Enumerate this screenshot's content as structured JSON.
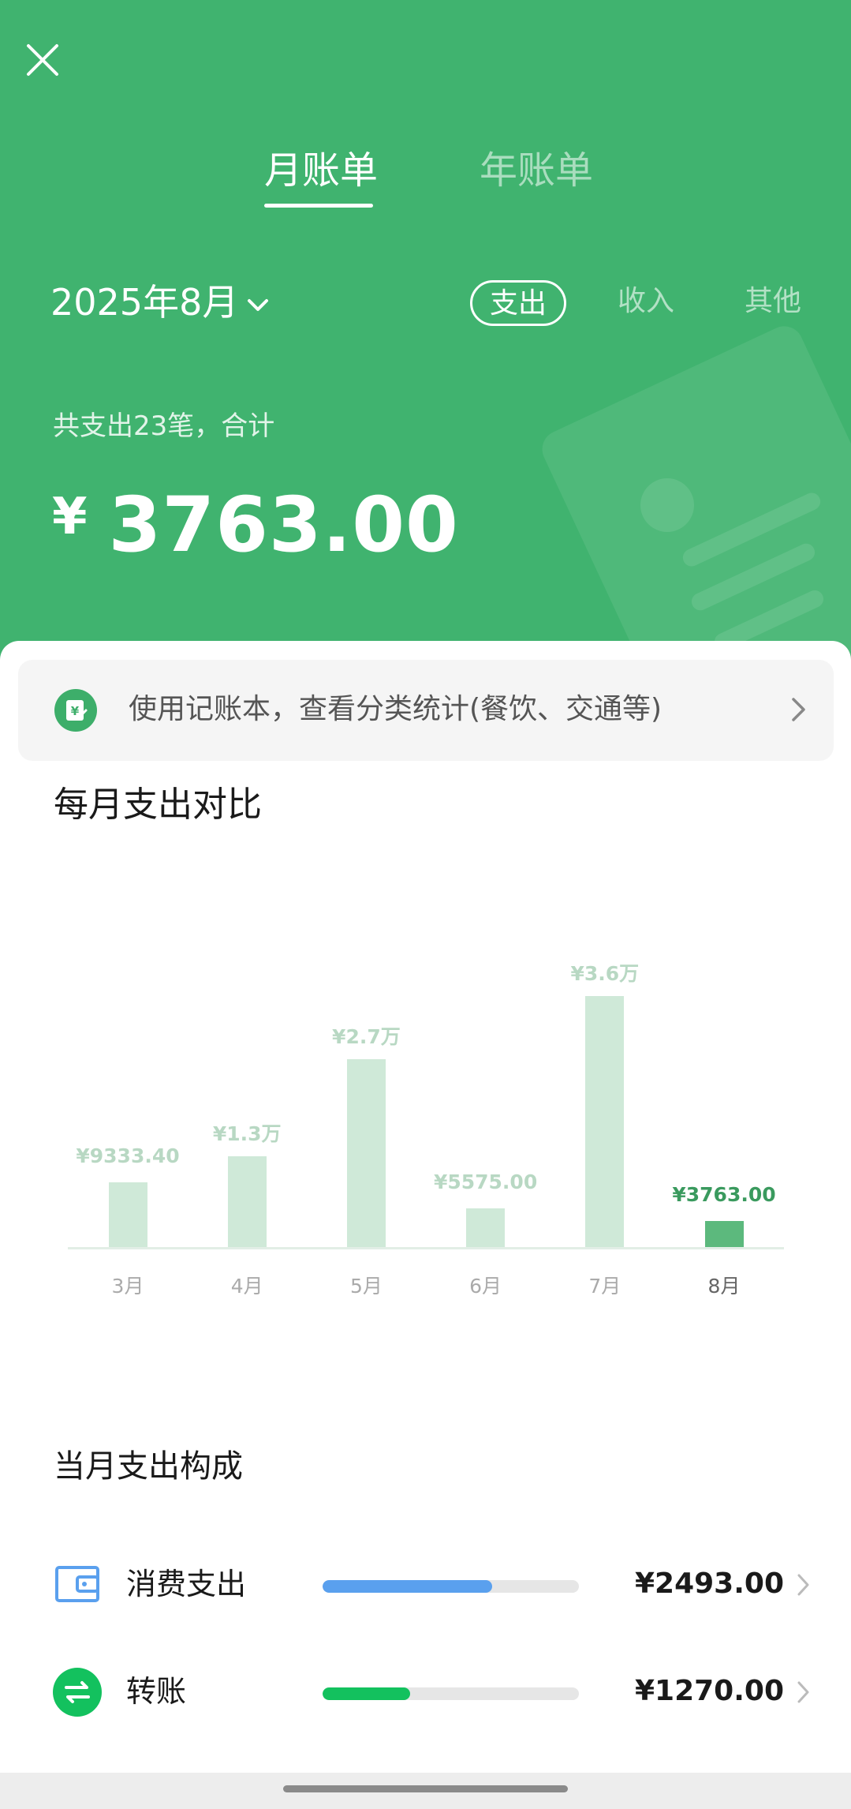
{
  "tabs": {
    "monthly": "月账单",
    "yearly": "年账单"
  },
  "period": {
    "label": "2025年8月"
  },
  "filters": {
    "expense": "支出",
    "income": "收入",
    "other": "其他"
  },
  "summary": {
    "text": "共支出23笔，合计",
    "currency": "¥",
    "amount": "3763.00"
  },
  "promo": {
    "text": "使用记账本，查看分类统计(餐饮、交通等)"
  },
  "comparison": {
    "title": "每月支出对比"
  },
  "chart_data": {
    "type": "bar",
    "categories": [
      "3月",
      "4月",
      "5月",
      "6月",
      "7月",
      "8月"
    ],
    "values": [
      9333.4,
      13000,
      27000,
      5575.0,
      36000,
      3763.0
    ],
    "data_labels": [
      "¥9333.40",
      "¥1.3万",
      "¥2.7万",
      "¥5575.00",
      "¥3.6万",
      "¥3763.00"
    ],
    "highlighted": "8月",
    "ylim": [
      0,
      36000
    ],
    "colors": {
      "bar": "#cfe9d8",
      "highlight": "#5cb97d"
    }
  },
  "composition": {
    "title": "当月支出构成",
    "items": [
      {
        "label": "消费支出",
        "amount": "¥2493.00",
        "share": 0.66,
        "color": "#5aa0ee",
        "icon": "wallet-icon"
      },
      {
        "label": "转账",
        "amount": "¥1270.00",
        "share": 0.34,
        "color": "#13c15e",
        "icon": "transfer-icon"
      }
    ]
  },
  "colors": {
    "brand": "#40b36f",
    "accent": "#3dae6a"
  }
}
